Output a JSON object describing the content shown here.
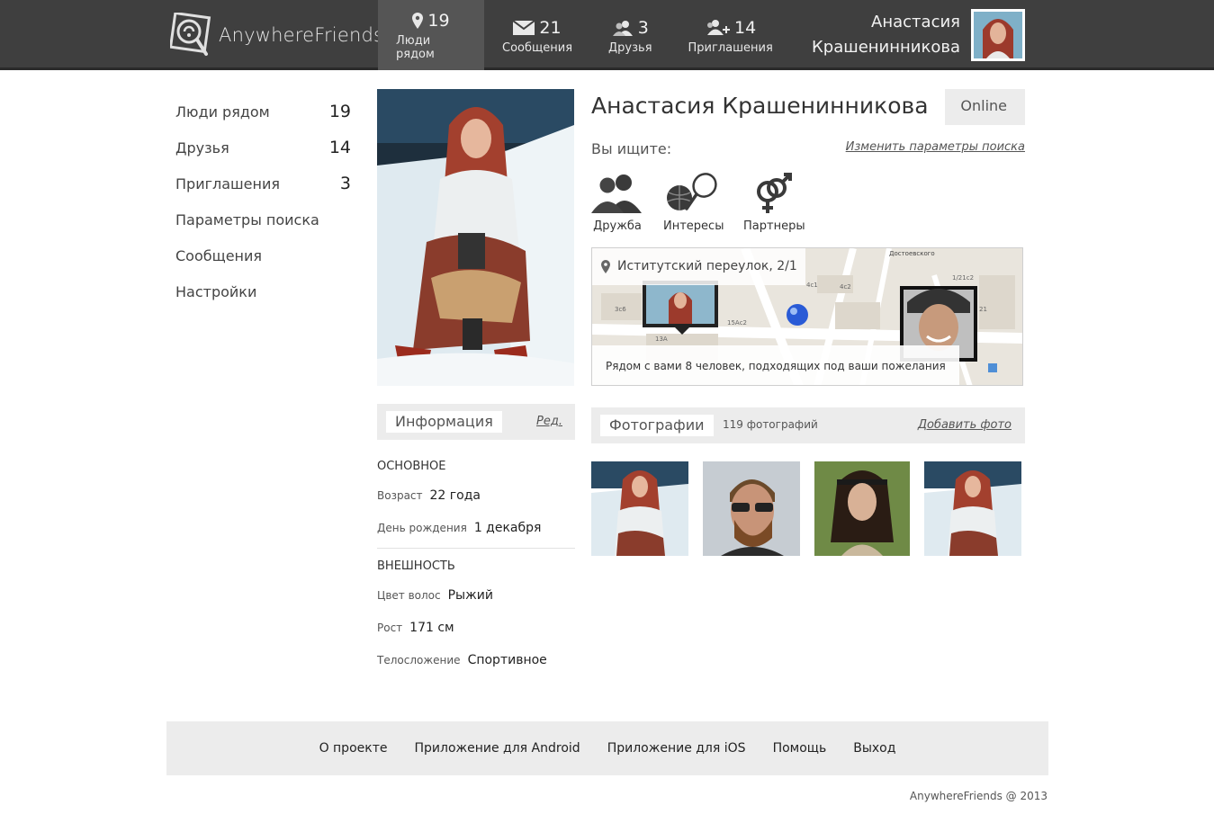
{
  "brand": {
    "name": "AnywhereFriends"
  },
  "nav": [
    {
      "count": "19",
      "label": "Люди рядом",
      "icon": "location-pin-icon"
    },
    {
      "count": "21",
      "label": "Сообщения",
      "icon": "envelope-icon"
    },
    {
      "count": "3",
      "label": "Друзья",
      "icon": "friends-icon"
    },
    {
      "count": "14",
      "label": "Приглашения",
      "icon": "invite-icon"
    }
  ],
  "user": {
    "first_name": "Анастасия",
    "last_name": "Крашенинникова"
  },
  "sidebar": [
    {
      "label": "Люди рядом",
      "count": "19"
    },
    {
      "label": "Друзья",
      "count": "14"
    },
    {
      "label": "Приглашения",
      "count": "3"
    },
    {
      "label": "Параметры поиска",
      "count": ""
    },
    {
      "label": "Сообщения",
      "count": ""
    },
    {
      "label": "Настройки",
      "count": ""
    }
  ],
  "profile": {
    "name": "Анастасия Крашенинникова",
    "status": "Online"
  },
  "info": {
    "tab": "Информация",
    "edit": "Ред.",
    "basic_title": "ОСНОВНОЕ",
    "age_key": "Возраст",
    "age_val": "22 года",
    "bday_key": "День рождения",
    "bday_val": "1 декабря",
    "look_title": "ВНЕШНОСТЬ",
    "hair_key": "Цвет волос",
    "hair_val": "Рыжий",
    "height_key": "Рост",
    "height_val": "171 см",
    "build_key": "Телосложение",
    "build_val": "Спортивное"
  },
  "seek": {
    "label": "Вы ищите:",
    "change": "Изменить параметры поиска",
    "items": [
      "Дружба",
      "Интересы",
      "Партнеры"
    ]
  },
  "map": {
    "address": "Иститутский переулок, 2/1",
    "nearby": "Рядом с вами 8 человек, подходящих под ваши пожелания",
    "street_labels": [
      "Достоевского",
      "1/21с2",
      "13А",
      "4с2",
      "4с1",
      "3с6",
      "15Ас2",
      "21"
    ]
  },
  "photos": {
    "tab": "Фотографии",
    "count": "119 фотографий",
    "add": "Добавить фото"
  },
  "footer": {
    "links": [
      "О проекте",
      "Приложение для Android",
      "Приложение для iOS",
      "Помощь",
      "Выход"
    ],
    "copyright": "AnywhereFriends @ 2013"
  },
  "colors": {
    "topbar": "#3f3f3f",
    "active_tab": "#555555",
    "panel": "#ececec"
  }
}
